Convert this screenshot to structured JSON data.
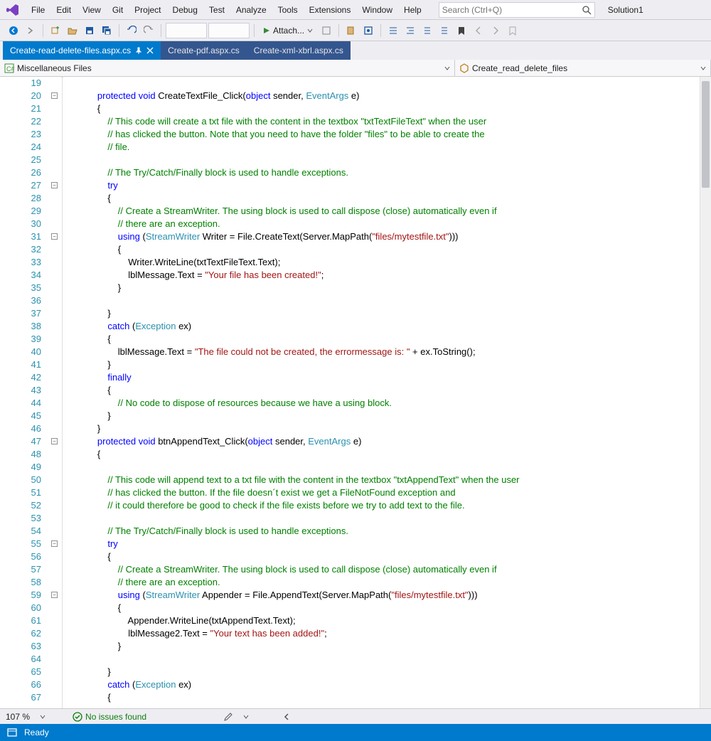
{
  "menu": [
    "File",
    "Edit",
    "View",
    "Git",
    "Project",
    "Debug",
    "Test",
    "Analyze",
    "Tools",
    "Extensions",
    "Window",
    "Help"
  ],
  "search_placeholder": "Search (Ctrl+Q)",
  "solution_name": "Solution1",
  "toolbar": {
    "attach_label": "Attach..."
  },
  "tabs": [
    {
      "label": "Create-read-delete-files.aspx.cs",
      "active": true
    },
    {
      "label": "Create-pdf.aspx.cs",
      "active": false
    },
    {
      "label": "Create-xml-xbrl.aspx.cs",
      "active": false
    }
  ],
  "nav": {
    "project": "Miscellaneous Files",
    "symbol": "Create_read_delete_files"
  },
  "editor": {
    "first_line": 19,
    "folds": [
      20,
      27,
      31,
      47,
      55,
      59
    ],
    "lines": [
      {
        "n": 19,
        "i": 3,
        "t": []
      },
      {
        "n": 20,
        "i": 2,
        "t": [
          [
            "kw",
            "protected"
          ],
          [
            "txt",
            " "
          ],
          [
            "kw",
            "void"
          ],
          [
            "txt",
            " CreateTextFile_Click("
          ],
          [
            "kw",
            "object"
          ],
          [
            "txt",
            " sender, "
          ],
          [
            "typ",
            "EventArgs"
          ],
          [
            "txt",
            " e)"
          ]
        ]
      },
      {
        "n": 21,
        "i": 2,
        "t": [
          [
            "txt",
            "{"
          ]
        ]
      },
      {
        "n": 22,
        "i": 3,
        "t": [
          [
            "cmt",
            "// This code will create a txt file with the content in the textbox \"txtTextFileText\" when the user"
          ]
        ]
      },
      {
        "n": 23,
        "i": 3,
        "t": [
          [
            "cmt",
            "// has clicked the button. Note that you need to have the folder \"files\" to be able to create the"
          ]
        ]
      },
      {
        "n": 24,
        "i": 3,
        "t": [
          [
            "cmt",
            "// file."
          ]
        ]
      },
      {
        "n": 25,
        "i": 3,
        "t": []
      },
      {
        "n": 26,
        "i": 3,
        "t": [
          [
            "cmt",
            "// The Try/Catch/Finally block is used to handle exceptions."
          ]
        ]
      },
      {
        "n": 27,
        "i": 3,
        "t": [
          [
            "kw",
            "try"
          ]
        ]
      },
      {
        "n": 28,
        "i": 3,
        "t": [
          [
            "txt",
            "{"
          ]
        ]
      },
      {
        "n": 29,
        "i": 4,
        "t": [
          [
            "cmt",
            "// Create a StreamWriter. The using block is used to call dispose (close) automatically even if"
          ]
        ]
      },
      {
        "n": 30,
        "i": 4,
        "t": [
          [
            "cmt",
            "// there are an exception."
          ]
        ]
      },
      {
        "n": 31,
        "i": 4,
        "t": [
          [
            "kw",
            "using"
          ],
          [
            "txt",
            " ("
          ],
          [
            "typ",
            "StreamWriter"
          ],
          [
            "txt",
            " Writer = File.CreateText(Server.MapPath("
          ],
          [
            "str",
            "\"files/mytestfile.txt\""
          ],
          [
            "txt",
            ")))"
          ]
        ]
      },
      {
        "n": 32,
        "i": 4,
        "t": [
          [
            "txt",
            "{"
          ]
        ]
      },
      {
        "n": 33,
        "i": 5,
        "t": [
          [
            "txt",
            "Writer.WriteLine(txtTextFileText.Text);"
          ]
        ]
      },
      {
        "n": 34,
        "i": 5,
        "t": [
          [
            "txt",
            "lblMessage.Text = "
          ],
          [
            "str",
            "\"Your file has been created!\""
          ],
          [
            "txt",
            ";"
          ]
        ]
      },
      {
        "n": 35,
        "i": 4,
        "t": [
          [
            "txt",
            "}"
          ]
        ]
      },
      {
        "n": 36,
        "i": 3,
        "t": []
      },
      {
        "n": 37,
        "i": 3,
        "t": [
          [
            "txt",
            "}"
          ]
        ]
      },
      {
        "n": 38,
        "i": 3,
        "t": [
          [
            "kw",
            "catch"
          ],
          [
            "txt",
            " ("
          ],
          [
            "typ",
            "Exception"
          ],
          [
            "txt",
            " ex)"
          ]
        ]
      },
      {
        "n": 39,
        "i": 3,
        "t": [
          [
            "txt",
            "{"
          ]
        ]
      },
      {
        "n": 40,
        "i": 4,
        "t": [
          [
            "txt",
            "lblMessage.Text = "
          ],
          [
            "str",
            "\"The file could not be created, the errormessage is: \""
          ],
          [
            "txt",
            " + ex.ToString();"
          ]
        ]
      },
      {
        "n": 41,
        "i": 3,
        "t": [
          [
            "txt",
            "}"
          ]
        ]
      },
      {
        "n": 42,
        "i": 3,
        "t": [
          [
            "kw",
            "finally"
          ]
        ]
      },
      {
        "n": 43,
        "i": 3,
        "t": [
          [
            "txt",
            "{"
          ]
        ]
      },
      {
        "n": 44,
        "i": 4,
        "t": [
          [
            "cmt",
            "// No code to dispose of resources because we have a using block."
          ]
        ]
      },
      {
        "n": 45,
        "i": 3,
        "t": [
          [
            "txt",
            "}"
          ]
        ]
      },
      {
        "n": 46,
        "i": 2,
        "t": [
          [
            "txt",
            "}"
          ]
        ]
      },
      {
        "n": 47,
        "i": 2,
        "t": [
          [
            "kw",
            "protected"
          ],
          [
            "txt",
            " "
          ],
          [
            "kw",
            "void"
          ],
          [
            "txt",
            " btnAppendText_Click("
          ],
          [
            "kw",
            "object"
          ],
          [
            "txt",
            " sender, "
          ],
          [
            "typ",
            "EventArgs"
          ],
          [
            "txt",
            " e)"
          ]
        ]
      },
      {
        "n": 48,
        "i": 2,
        "t": [
          [
            "txt",
            "{"
          ]
        ]
      },
      {
        "n": 49,
        "i": 3,
        "t": []
      },
      {
        "n": 50,
        "i": 3,
        "t": [
          [
            "cmt",
            "// This code will append text to a txt file with the content in the textbox \"txtAppendText\" when the user"
          ]
        ]
      },
      {
        "n": 51,
        "i": 3,
        "t": [
          [
            "cmt",
            "// has clicked the button. If the file doesn´t exist we get a FileNotFound exception and"
          ]
        ]
      },
      {
        "n": 52,
        "i": 3,
        "t": [
          [
            "cmt",
            "// it could therefore be good to check if the file exists before we try to add text to the file."
          ]
        ]
      },
      {
        "n": 53,
        "i": 3,
        "t": []
      },
      {
        "n": 54,
        "i": 3,
        "t": [
          [
            "cmt",
            "// The Try/Catch/Finally block is used to handle exceptions."
          ]
        ]
      },
      {
        "n": 55,
        "i": 3,
        "t": [
          [
            "kw",
            "try"
          ]
        ]
      },
      {
        "n": 56,
        "i": 3,
        "t": [
          [
            "txt",
            "{"
          ]
        ]
      },
      {
        "n": 57,
        "i": 4,
        "t": [
          [
            "cmt",
            "// Create a StreamWriter. The using block is used to call dispose (close) automatically even if"
          ]
        ]
      },
      {
        "n": 58,
        "i": 4,
        "t": [
          [
            "cmt",
            "// there are an exception."
          ]
        ]
      },
      {
        "n": 59,
        "i": 4,
        "t": [
          [
            "kw",
            "using"
          ],
          [
            "txt",
            " ("
          ],
          [
            "typ",
            "StreamWriter"
          ],
          [
            "txt",
            " Appender = File.AppendText(Server.MapPath("
          ],
          [
            "str",
            "\"files/mytestfile.txt\""
          ],
          [
            "txt",
            ")))"
          ]
        ]
      },
      {
        "n": 60,
        "i": 4,
        "t": [
          [
            "txt",
            "{"
          ]
        ]
      },
      {
        "n": 61,
        "i": 5,
        "t": [
          [
            "txt",
            "Appender.WriteLine(txtAppendText.Text);"
          ]
        ]
      },
      {
        "n": 62,
        "i": 5,
        "t": [
          [
            "txt",
            "lblMessage2.Text = "
          ],
          [
            "str",
            "\"Your text has been added!\""
          ],
          [
            "txt",
            ";"
          ]
        ]
      },
      {
        "n": 63,
        "i": 4,
        "t": [
          [
            "txt",
            "}"
          ]
        ]
      },
      {
        "n": 64,
        "i": 3,
        "t": []
      },
      {
        "n": 65,
        "i": 3,
        "t": [
          [
            "txt",
            "}"
          ]
        ]
      },
      {
        "n": 66,
        "i": 3,
        "t": [
          [
            "kw",
            "catch"
          ],
          [
            "txt",
            " ("
          ],
          [
            "typ",
            "Exception"
          ],
          [
            "txt",
            " ex)"
          ]
        ]
      },
      {
        "n": 67,
        "i": 3,
        "t": [
          [
            "txt",
            "{"
          ]
        ]
      }
    ]
  },
  "footer": {
    "zoom": "107 %",
    "issues": "No issues found"
  },
  "status": {
    "text": "Ready"
  }
}
